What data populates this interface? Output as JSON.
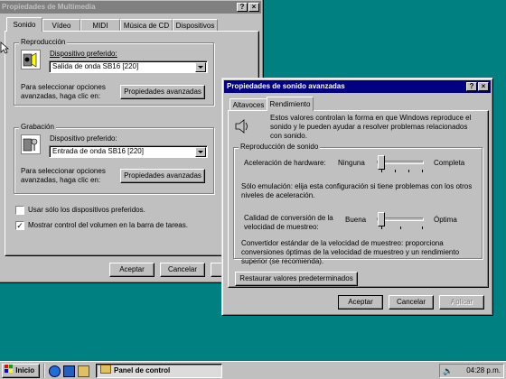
{
  "back_window": {
    "title": "Propiedades de Multimedia",
    "help_btn": "?",
    "close_btn": "×",
    "tabs": [
      "Sonido",
      "Vídeo",
      "MIDI",
      "Música de CD",
      "Dispositivos"
    ],
    "reproduccion": {
      "group_label": "Reproducción",
      "preferred_label": "Dispositivo preferido:",
      "preferred_value": "Salida de onda SB16 [220]",
      "advanced_text": "Para seleccionar opciones avanzadas, haga clic en:",
      "advanced_button": "Propiedades avanzadas"
    },
    "grabacion": {
      "group_label": "Grabación",
      "preferred_label": "Dispositivo preferido:",
      "preferred_value": "Entrada de onda SB16 [220]",
      "advanced_text": "Para seleccionar opciones avanzadas, haga clic en:",
      "advanced_button": "Propiedades avanzadas"
    },
    "checkbox_preferred": {
      "label": "Usar sólo los dispositivos preferidos.",
      "checked": false
    },
    "checkbox_volume": {
      "label": "Mostrar control del volumen en la barra de tareas.",
      "checked": true
    },
    "buttons": {
      "ok": "Aceptar",
      "cancel": "Cancelar"
    }
  },
  "front_window": {
    "title": "Propiedades de sonido avanzadas",
    "help_btn": "?",
    "close_btn": "×",
    "tabs": [
      "Altavoces",
      "Rendimiento"
    ],
    "active_tab": "Rendimiento",
    "intro_text": "Estos valores controlan la forma en que Windows reproduce el sonido y le pueden ayudar a resolver problemas relacionados con sonido.",
    "group_label": "Reproducción de sonido",
    "hw_accel": {
      "label": "Aceleración de hardware:",
      "min": "Ninguna",
      "max": "Completa",
      "level_fraction": 0.0
    },
    "emulation_note": "Sólo emulación: elija esta configuración si tiene problemas con los otros niveles de aceleración.",
    "src_quality": {
      "label": "Calidad de conversión de la velocidad de muestreo:",
      "min": "Buena",
      "max": "Óptima",
      "level_fraction": 0.0
    },
    "converter_note": "Convertidor estándar de la velocidad de muestreo:  proporciona conversiones óptimas de la velocidad de muestreo y un rendimiento superior (se recomienda).",
    "restore_button": "Restaurar valores predeterminados",
    "buttons": {
      "ok": "Aceptar",
      "cancel": "Cancelar",
      "apply": "Aplicar"
    }
  },
  "taskbar": {
    "start": "Inicio",
    "task": "Panel de control",
    "clock": "04:28 p.m."
  },
  "colors": {
    "desktop": "#008080",
    "title_active": "#000080",
    "title_inactive": "#808080",
    "face": "#c0c0c0"
  }
}
